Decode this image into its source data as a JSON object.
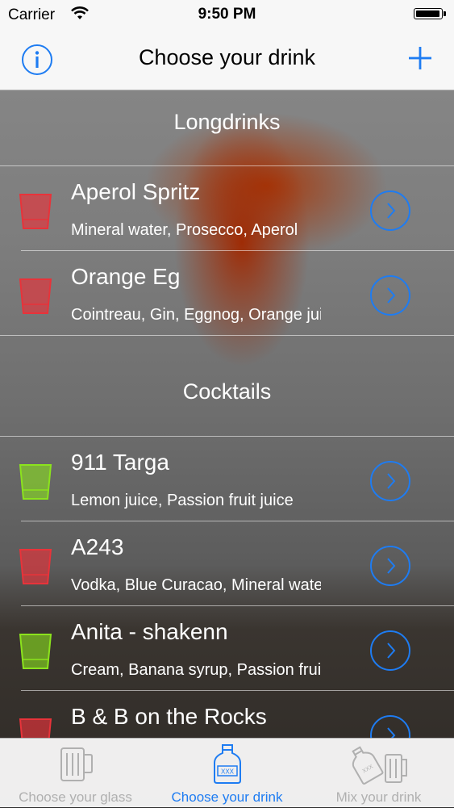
{
  "status_bar": {
    "carrier": "Carrier",
    "time": "9:50 PM",
    "battery_level": 1.0
  },
  "nav_bar": {
    "title": "Choose your drink",
    "left_icon": "info-icon",
    "right_icon": "plus-icon"
  },
  "colors": {
    "accent": "#1e7cf2",
    "glass_red": "#e8333a",
    "glass_green": "#8be31d",
    "tab_inactive": "#b0b0b0"
  },
  "sections": [
    {
      "header": "Longdrinks",
      "rows": [
        {
          "title": "Aperol Spritz",
          "subtitle": "Mineral water, Prosecco, Aperol",
          "glass_color": "red"
        },
        {
          "title": "Orange Eg",
          "subtitle": "Cointreau, Gin, Eggnog, Orange juice",
          "glass_color": "red"
        }
      ]
    },
    {
      "header": "Cocktails",
      "rows": [
        {
          "title": "911 Targa",
          "subtitle": "Lemon juice, Passion fruit juice",
          "glass_color": "green"
        },
        {
          "title": "A243",
          "subtitle": "Vodka, Blue Curacao, Mineral water",
          "glass_color": "red"
        },
        {
          "title": "Anita - shakenn",
          "subtitle": "Cream, Banana syrup, Passion fruit",
          "glass_color": "green"
        },
        {
          "title": "B & B on the Rocks",
          "subtitle": "",
          "glass_color": "red"
        }
      ]
    }
  ],
  "tab_bar": {
    "tabs": [
      {
        "label": "Choose your glass",
        "icon": "beer-mug-icon",
        "active": false
      },
      {
        "label": "Choose your drink",
        "icon": "bottle-icon",
        "active": true
      },
      {
        "label": "Mix your drink",
        "icon": "bottle-and-mug-icon",
        "active": false
      }
    ]
  }
}
